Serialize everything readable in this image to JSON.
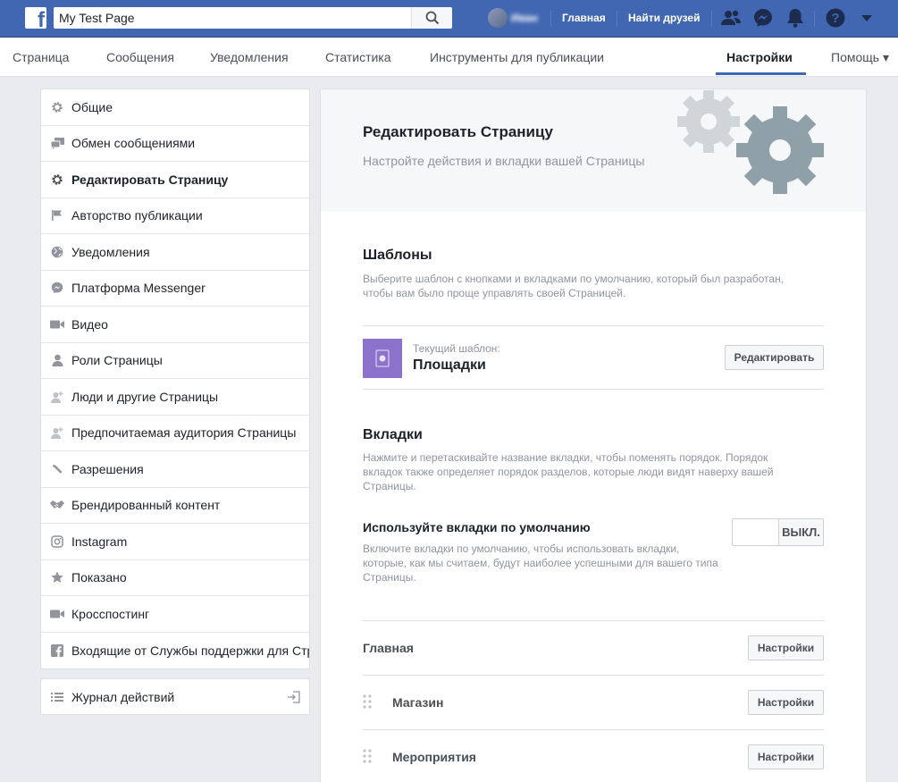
{
  "topbar": {
    "search_value": "My Test Page",
    "user_name": "Иван",
    "links": [
      "Главная",
      "Найти друзей"
    ]
  },
  "subnav": {
    "items": [
      "Страница",
      "Сообщения",
      "Уведомления",
      "Статистика",
      "Инструменты для публикации",
      "Настройки",
      "Помощь ▾"
    ],
    "active": "Настройки"
  },
  "sidebar": {
    "items": [
      {
        "label": "Общие",
        "icon": "gear-icon"
      },
      {
        "label": "Обмен сообщениями",
        "icon": "chat-icon"
      },
      {
        "label": "Редактировать Страницу",
        "icon": "gear-icon",
        "active": true
      },
      {
        "label": "Авторство публикации",
        "icon": "flag-icon"
      },
      {
        "label": "Уведомления",
        "icon": "globe-icon"
      },
      {
        "label": "Платформа Messenger",
        "icon": "messenger-icon"
      },
      {
        "label": "Видео",
        "icon": "video-icon"
      },
      {
        "label": "Роли Страницы",
        "icon": "person-icon"
      },
      {
        "label": "Люди и другие Страницы",
        "icon": "person-add-icon"
      },
      {
        "label": "Предпочитаемая аудитория Страницы",
        "icon": "person-add-icon"
      },
      {
        "label": "Разрешения",
        "icon": "wrench-icon"
      },
      {
        "label": "Брендированный контент",
        "icon": "handshake-icon"
      },
      {
        "label": "Instagram",
        "icon": "instagram-icon"
      },
      {
        "label": "Показано",
        "icon": "star-icon"
      },
      {
        "label": "Кросспостинг",
        "icon": "video-icon"
      },
      {
        "label": "Входящие от Службы поддержки для Страниц",
        "icon": "facebook-icon"
      }
    ],
    "activity_log": "Журнал действий"
  },
  "main": {
    "title": "Редактировать Страницу",
    "subtitle": "Настройте действия и вкладки вашей Страницы",
    "templates": {
      "title": "Шаблоны",
      "desc_line1": "Выберите шаблон с кнопками и вкладками по умолчанию, который был разработан,",
      "desc_line2": "чтобы вам было проще управлять своей Страницей.",
      "current_label": "Текущий шаблон:",
      "current_name": "Площадки",
      "edit_button": "Редактировать"
    },
    "tabs": {
      "title": "Вкладки",
      "desc_line1": "Нажмите и перетаскивайте название вкладки, чтобы поменять порядок. Порядок",
      "desc_line2": "вкладок также определяет порядок разделов, которые люди видят наверху вашей",
      "desc_line3": "Страницы.",
      "default_title": "Используйте вкладки по умолчанию",
      "default_desc_line1": "Включите вкладки по умолчанию, чтобы использовать вкладки,",
      "default_desc_line2": "которые, как мы считаем, будут наиболее успешными для вашего типа",
      "default_desc_line3": "Страницы.",
      "toggle_state": "ВЫКЛ.",
      "rows": [
        {
          "label": "Главная",
          "button": "Настройки"
        },
        {
          "label": "Магазин",
          "button": "Настройки"
        },
        {
          "label": "Мероприятия",
          "button": "Настройки"
        }
      ]
    }
  },
  "colors": {
    "brand": "#4267b2",
    "template_thumb": "#8c72cb",
    "gear": "#90a0a8"
  }
}
